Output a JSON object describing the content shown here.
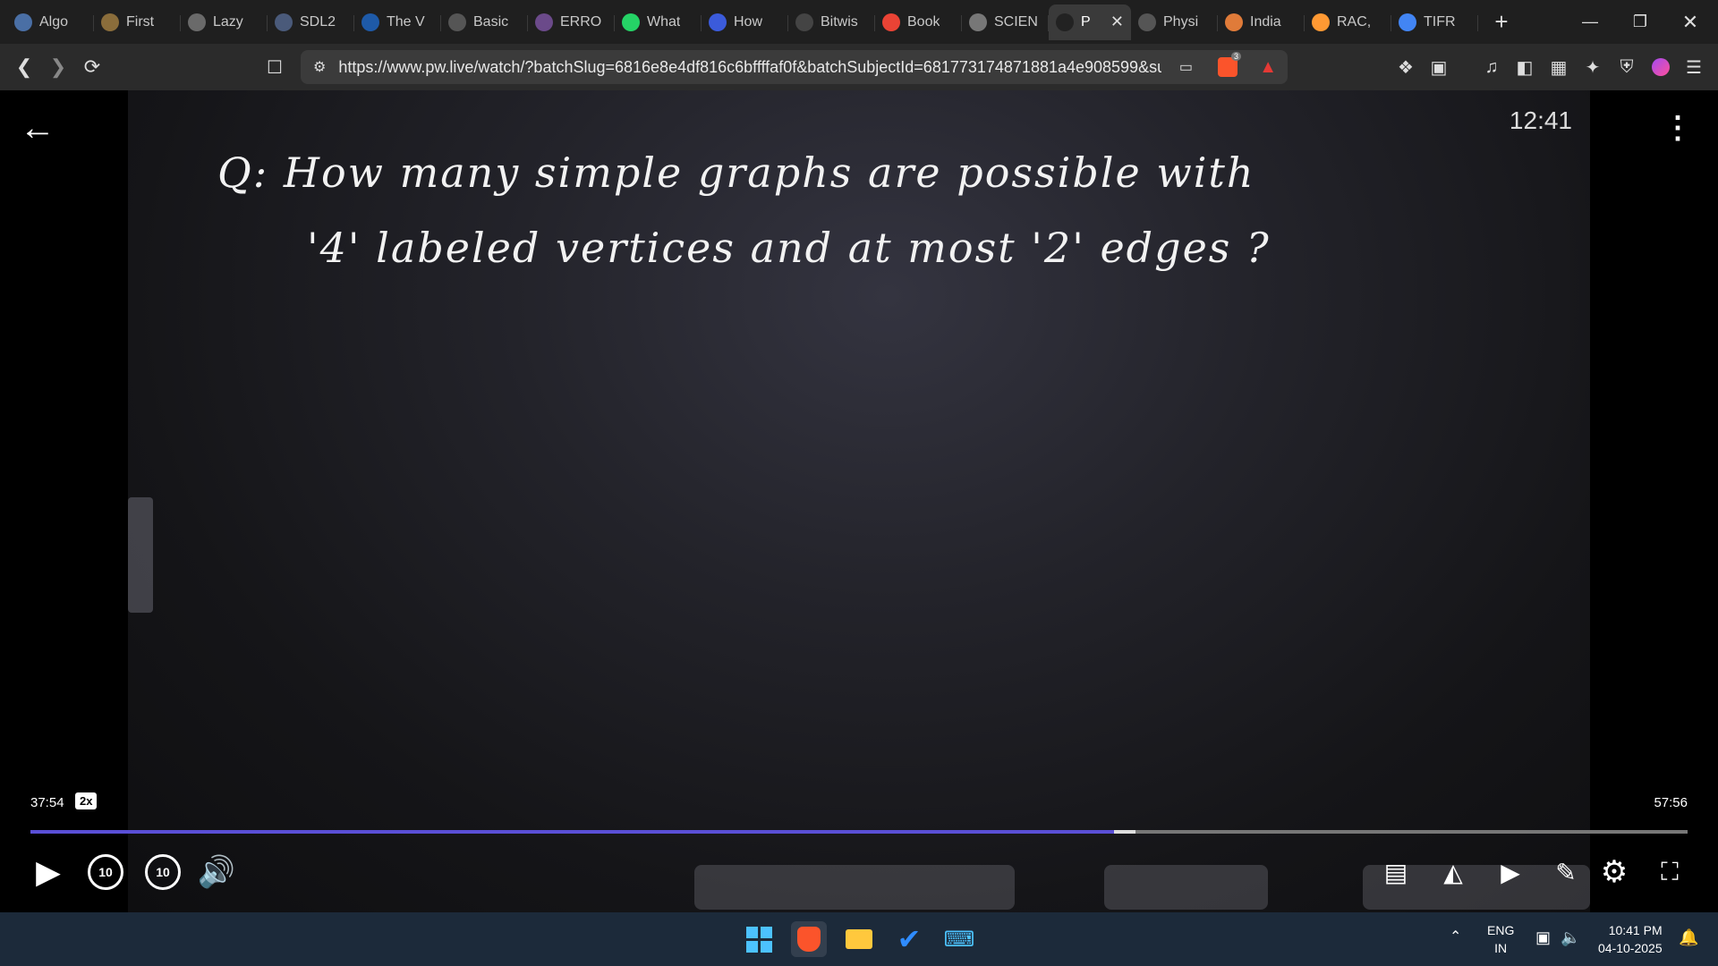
{
  "tabs": [
    {
      "label": "Algo",
      "favicon_color": "#4a6fa5"
    },
    {
      "label": "First",
      "favicon_color": "#8a6d3b"
    },
    {
      "label": "Lazy",
      "favicon_color": "#6a6a6a"
    },
    {
      "label": "SDL2",
      "favicon_color": "#4a5a7a"
    },
    {
      "label": "The V",
      "favicon_color": "#1e5aa8"
    },
    {
      "label": "Basic",
      "favicon_color": "#555555"
    },
    {
      "label": "ERRO",
      "favicon_color": "#6b4a8a"
    },
    {
      "label": "What",
      "favicon_color": "#25d366"
    },
    {
      "label": "How",
      "favicon_color": "#3b5bdb"
    },
    {
      "label": "Bitwis",
      "favicon_color": "#444444"
    },
    {
      "label": "Book",
      "favicon_color": "#ea4335"
    },
    {
      "label": "SCIEN",
      "favicon_color": "#777777"
    },
    {
      "label": "P",
      "favicon_color": "#222222",
      "active": true
    },
    {
      "label": "Physi",
      "favicon_color": "#555555"
    },
    {
      "label": "India",
      "favicon_color": "#e07b39"
    },
    {
      "label": "RAC,",
      "favicon_color": "#ff9933"
    },
    {
      "label": "TIFR",
      "favicon_color": "#4285f4"
    }
  ],
  "address": {
    "url": "https://www.pw.live/watch/?batchSlug=6816e8e4df816c6bffffaf0f&batchSubjectId=681773174871881a4e908599&su..."
  },
  "shield_badge": "3",
  "video": {
    "question_line1": "Q: How many simple graphs are possible with",
    "question_line2": "'4' labeled vertices and at most '2' edges ?",
    "overlay_time": "12:41"
  },
  "player": {
    "current_time": "37:54",
    "speed": "2x",
    "duration": "57:56",
    "progress_fraction": 0.654,
    "buffer_fraction": 0.667,
    "rewind_label": "10",
    "forward_label": "10"
  },
  "taskbar": {
    "lang_line1": "ENG",
    "lang_line2": "IN",
    "time": "10:41 PM",
    "date": "04-10-2025"
  },
  "colors": {
    "progress": "#5a4fd6",
    "taskbar": "#1c2a3a",
    "tabstrip": "#1f1f1f"
  }
}
